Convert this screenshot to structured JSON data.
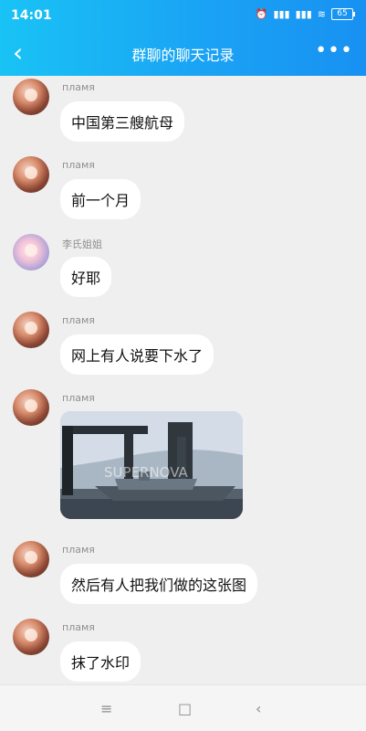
{
  "status": {
    "time": "14:01",
    "battery": "65"
  },
  "header": {
    "title": "群聊的聊天记录",
    "back_icon": "chevron-left-icon",
    "more_icon": "more-icon"
  },
  "messages": [
    {
      "sender": "пламя",
      "text": "中国第三艘航母"
    },
    {
      "sender": "пламя",
      "text": "前一个月"
    },
    {
      "sender": "李氏姐姐",
      "text": "好耶"
    },
    {
      "sender": "пламя",
      "text": "网上有人说要下水了"
    },
    {
      "sender": "пламя",
      "text": ""
    },
    {
      "sender": "пламя",
      "text": "然后有人把我们做的这张图"
    },
    {
      "sender": "пламя",
      "text": "抹了水印"
    }
  ],
  "image_text": "SUPERNOVA",
  "nav": {
    "menu_icon": "menu-icon",
    "home_icon": "home-square-icon",
    "back_icon": "back-icon"
  }
}
